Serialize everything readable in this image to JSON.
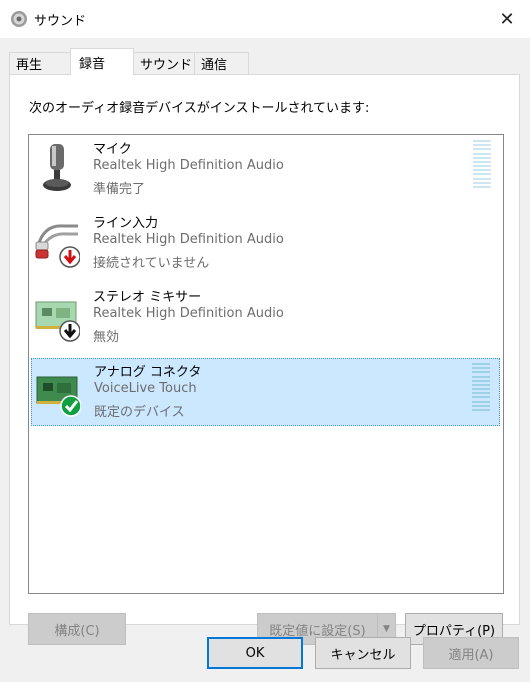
{
  "window": {
    "title": "サウンド",
    "close_glyph": "✕"
  },
  "tabs": [
    {
      "label": "再生"
    },
    {
      "label": "録音"
    },
    {
      "label": "サウンド"
    },
    {
      "label": "通信"
    }
  ],
  "panel": {
    "description": "次のオーディオ録音デバイスがインストールされています:"
  },
  "devices": [
    {
      "name": "マイク",
      "driver": "Realtek High Definition Audio",
      "status": "準備完了",
      "icon": "microphone-icon"
    },
    {
      "name": "ライン入力",
      "driver": "Realtek High Definition Audio",
      "status": "接続されていません",
      "icon": "line-in-icon",
      "badge": "red-down-arrow-icon"
    },
    {
      "name": "ステレオ ミキサー",
      "driver": "Realtek High Definition Audio",
      "status": "無効",
      "icon": "sound-card-icon",
      "badge": "black-down-arrow-icon"
    },
    {
      "name": "アナログ コネクタ",
      "driver": "VoiceLive Touch",
      "status": "既定のデバイス",
      "icon": "sound-card-icon",
      "badge": "green-check-icon",
      "selected": true
    }
  ],
  "buttons": {
    "configure": "構成(C)",
    "set_default": "既定値に設定(S)",
    "dropdown_glyph": "▼",
    "properties": "プロパティ(P)",
    "ok": "OK",
    "cancel": "キャンセル",
    "apply": "適用(A)"
  },
  "colors": {
    "selection": "#cce8ff",
    "accent": "#0078d7",
    "meter": "#cfe6f1"
  }
}
